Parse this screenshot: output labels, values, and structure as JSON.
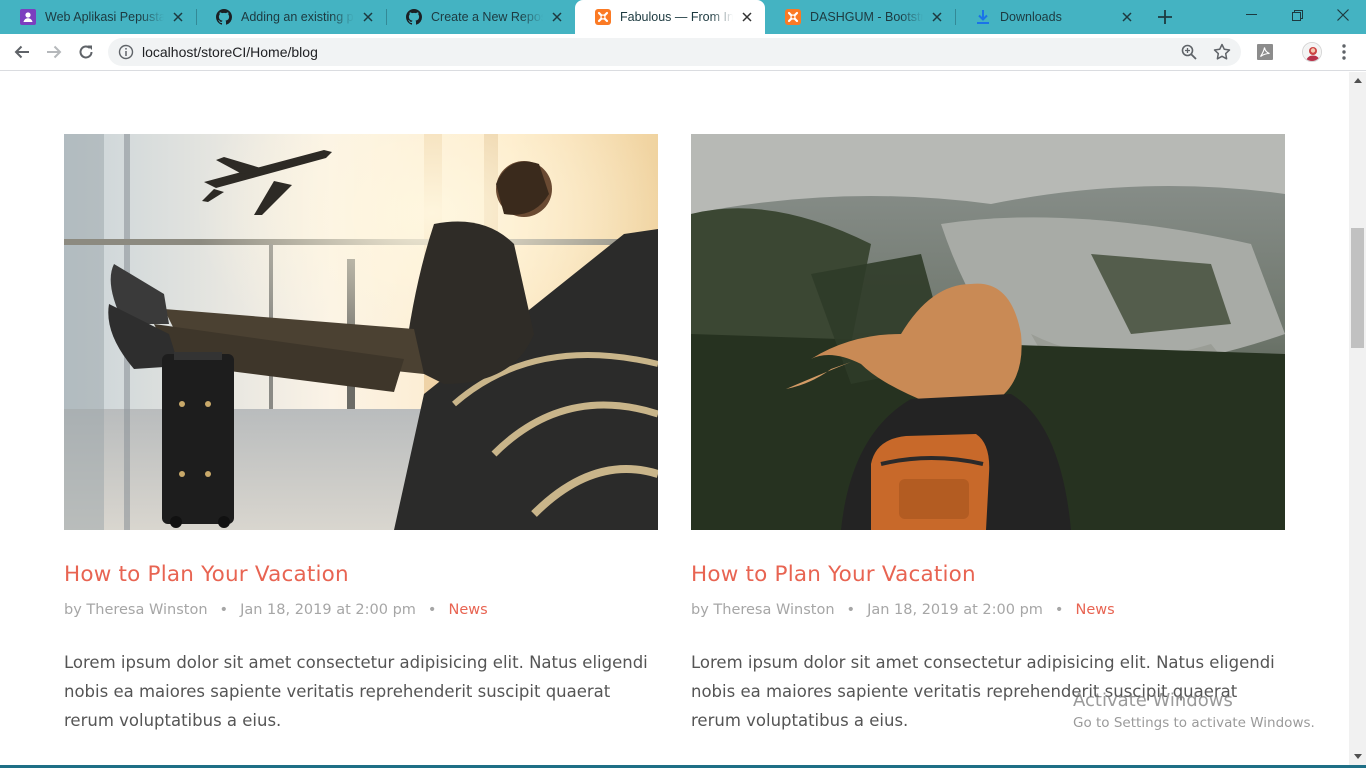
{
  "browser": {
    "tabs": [
      {
        "title": "Web Aplikasi Pepustakaan",
        "icon": "purple-app-icon",
        "active": false
      },
      {
        "title": "Adding an existing project",
        "icon": "github-icon",
        "active": false
      },
      {
        "title": "Create a New Repository",
        "icon": "github-icon",
        "active": false
      },
      {
        "title": "Fabulous — From Indonesia",
        "icon": "xampp-icon",
        "active": true
      },
      {
        "title": "DASHGUM - Bootstrap",
        "icon": "xampp-icon",
        "active": false
      },
      {
        "title": "Downloads",
        "icon": "download-icon",
        "active": false
      }
    ],
    "address": "localhost/storeCI/Home/blog",
    "colors": {
      "tabstrip": "#44b3c2",
      "accent": "#e86452"
    }
  },
  "posts": [
    {
      "image": "airport-traveler-photo",
      "title": "How to Plan Your Vacation",
      "author": "by Theresa Winston",
      "date": "Jan 18, 2019 at 2:00 pm",
      "category": "News",
      "excerpt": "Lorem ipsum dolor sit amet consectetur adipisicing elit. Natus eligendi nobis ea maiores sapiente veritatis reprehenderit suscipit quaerat rerum voluptatibus a eius."
    },
    {
      "image": "mountain-hiker-photo",
      "title": "How to Plan Your Vacation",
      "author": "by Theresa Winston",
      "date": "Jan 18, 2019 at 2:00 pm",
      "category": "News",
      "excerpt": "Lorem ipsum dolor sit amet consectetur adipisicing elit. Natus eligendi nobis ea maiores sapiente veritatis reprehenderit suscipit quaerat rerum voluptatibus a eius."
    }
  ],
  "meta_separator": "•",
  "watermark": {
    "line1": "Activate Windows",
    "line2": "Go to Settings to activate Windows."
  }
}
